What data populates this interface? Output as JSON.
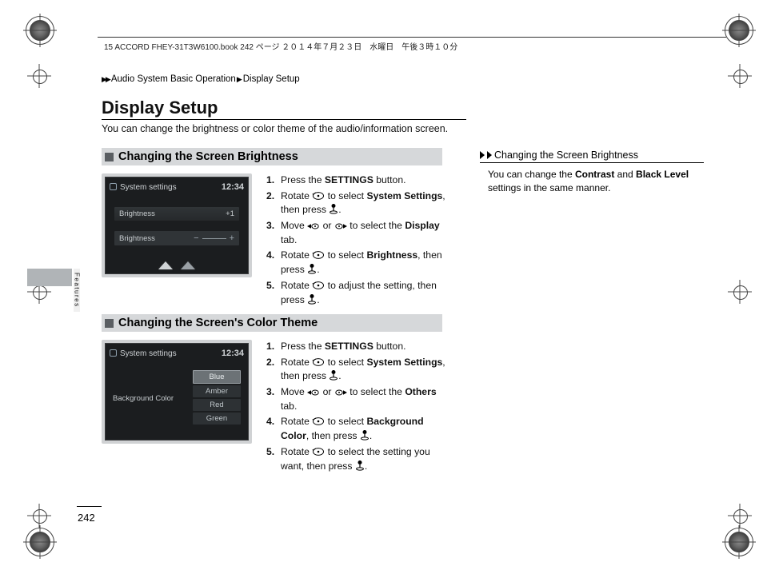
{
  "header": {
    "book_line": "15 ACCORD FHEY-31T3W6100.book  242 ページ  ２０１４年７月２３日　水曜日　午後３時１０分"
  },
  "breadcrumb": {
    "arrow": "▶▶",
    "a": "Audio System Basic Operation",
    "sep": "▶",
    "b": "Display Setup"
  },
  "title": "Display Setup",
  "intro": "You can change the brightness or color theme of the audio/information screen.",
  "section1": {
    "heading": "Changing the Screen Brightness",
    "screen": {
      "title": "System settings",
      "time": "12:34",
      "row1": "Brightness",
      "row1_val": "+1",
      "row2": "Brightness",
      "slider_minus": "−",
      "slider_plus": "+"
    },
    "steps": {
      "s1a": "Press the ",
      "s1b": "SETTINGS",
      "s1c": " button.",
      "s2a": "Rotate ",
      "s2b": " to select ",
      "s2c": "System Settings",
      "s2d": ", then press ",
      "s2e": ".",
      "s3a": "Move ",
      "s3b": " or ",
      "s3c": " to select the ",
      "s3d": "Display",
      "s3e": " tab.",
      "s4a": "Rotate ",
      "s4b": " to select ",
      "s4c": "Brightness",
      "s4d": ", then press ",
      "s4e": ".",
      "s5a": "Rotate ",
      "s5b": " to adjust the setting, then press ",
      "s5c": "."
    }
  },
  "section2": {
    "heading": "Changing the Screen's Color Theme",
    "screen": {
      "title": "System settings",
      "time": "12:34",
      "label": "Background Color",
      "options": {
        "o1": "Blue",
        "o2": "Amber",
        "o3": "Red",
        "o4": "Green"
      }
    },
    "steps": {
      "s1a": "Press the ",
      "s1b": "SETTINGS",
      "s1c": " button.",
      "s2a": "Rotate ",
      "s2b": " to select ",
      "s2c": "System Settings",
      "s2d": ", then press ",
      "s2e": ".",
      "s3a": "Move ",
      "s3b": " or ",
      "s3c": " to select the ",
      "s3d": "Others",
      "s3e": " tab.",
      "s4a": "Rotate ",
      "s4b": " to select ",
      "s4c": "Background Color",
      "s4d": ", then press ",
      "s4e": ".",
      "s5a": "Rotate ",
      "s5b": " to select the setting you want, then press ",
      "s5c": "."
    }
  },
  "sidebar": {
    "heading": "Changing the Screen Brightness",
    "body_a": "You can change the ",
    "body_b": "Contrast",
    "body_c": " and ",
    "body_d": "Black Level",
    "body_e": " settings in the same manner."
  },
  "page_number": "242",
  "tab": "Features"
}
